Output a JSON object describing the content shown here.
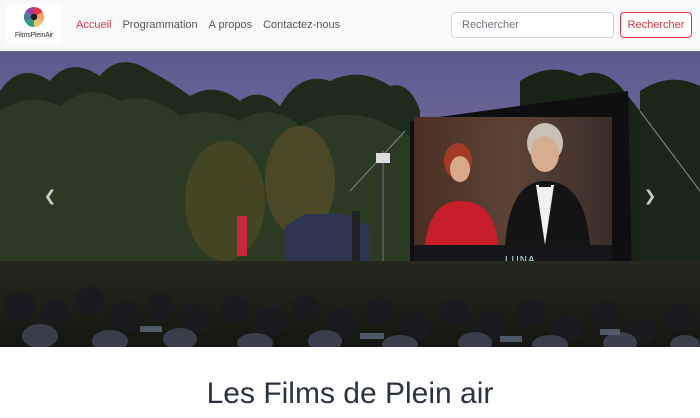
{
  "brand": {
    "name": "FilmsPleinAir"
  },
  "nav": {
    "items": [
      {
        "label": "Accueil",
        "active": true
      },
      {
        "label": "Programmation",
        "active": false
      },
      {
        "label": "A propos",
        "active": false
      },
      {
        "label": "Contactez-nous",
        "active": false
      }
    ]
  },
  "search": {
    "placeholder": "Rechercher",
    "button_label": "Rechercher"
  },
  "carousel": {
    "prev_icon": "chevron-left-icon",
    "next_icon": "chevron-right-icon",
    "screen_logo": "LUNA"
  },
  "main": {
    "title": "Les Films de Plein air"
  },
  "colors": {
    "accent": "#dc3545",
    "navbar_bg": "#f8f9fa",
    "title": "#2b3440"
  }
}
